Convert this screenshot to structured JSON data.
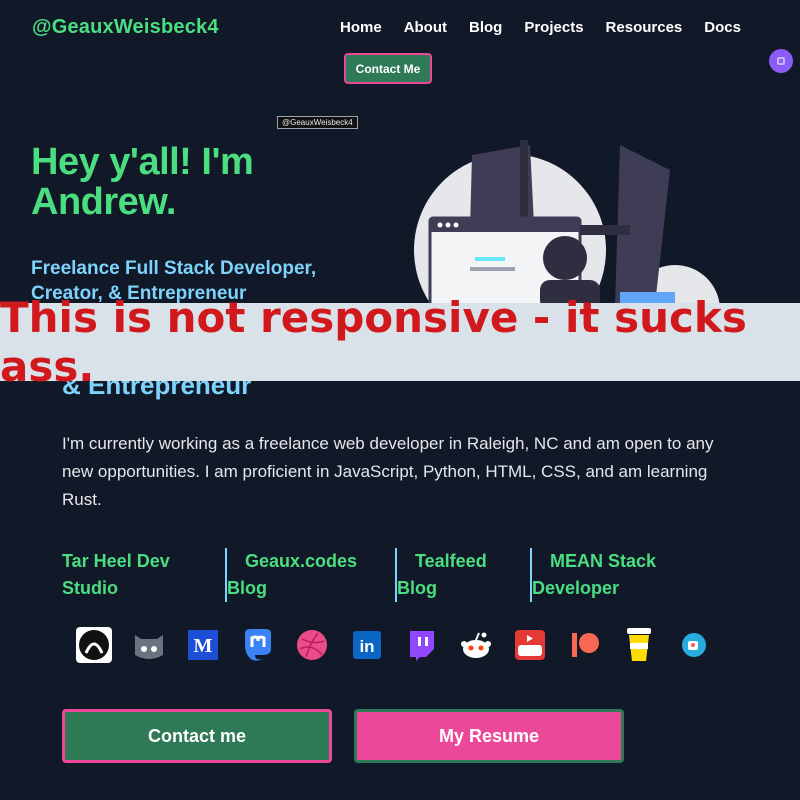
{
  "header": {
    "brand": "@GeauxWeisbeck4",
    "nav": [
      "Home",
      "About",
      "Blog",
      "Projects",
      "Resources",
      "Docs"
    ],
    "contact_button": "Contact Me",
    "theme_toggle_icon": "moon-icon"
  },
  "tooltip": "@GeauxWeisbeck4",
  "hero": {
    "title_line1": "Hey y'all! I'm",
    "title_line2": "Andrew.",
    "subtitle_line1": "Freelance Full Stack Developer,",
    "subtitle_line2": "Creator, & Entrepreneur",
    "subtitle_lower": "& Entrepreneur"
  },
  "banner": {
    "text": "This is not responsive - it sucks ass."
  },
  "bio": "I'm currently working as a freelance web developer in Raleigh, NC and am open to any new opportunities. I am proficient in JavaScript, Python, HTML, CSS, and am learning Rust.",
  "links": [
    {
      "line1": "Tar Heel Dev",
      "line2": "Studio"
    },
    {
      "line1": "Geaux.codes",
      "line2": "Blog"
    },
    {
      "line1": "Tealfeed",
      "line2": "Blog"
    },
    {
      "line1": "MEAN Stack",
      "line2": "Developer"
    }
  ],
  "social_icons": [
    "github-octocat-icon",
    "github-cat-icon",
    "medium-icon",
    "mastodon-icon",
    "dribbble-icon",
    "linkedin-icon",
    "twitch-icon",
    "reddit-icon",
    "youtube-icon",
    "patreon-icon",
    "buymeacoffee-icon",
    "kofi-icon"
  ],
  "social_labels": {
    "medium": "M",
    "linkedin": "in"
  },
  "buttons": {
    "contact": "Contact me",
    "resume": "My Resume"
  },
  "colors": {
    "background": "#111827",
    "green": "#4ade80",
    "blue": "#7dd3fc",
    "pink": "#ec4899",
    "banner_text": "#d1181c"
  }
}
